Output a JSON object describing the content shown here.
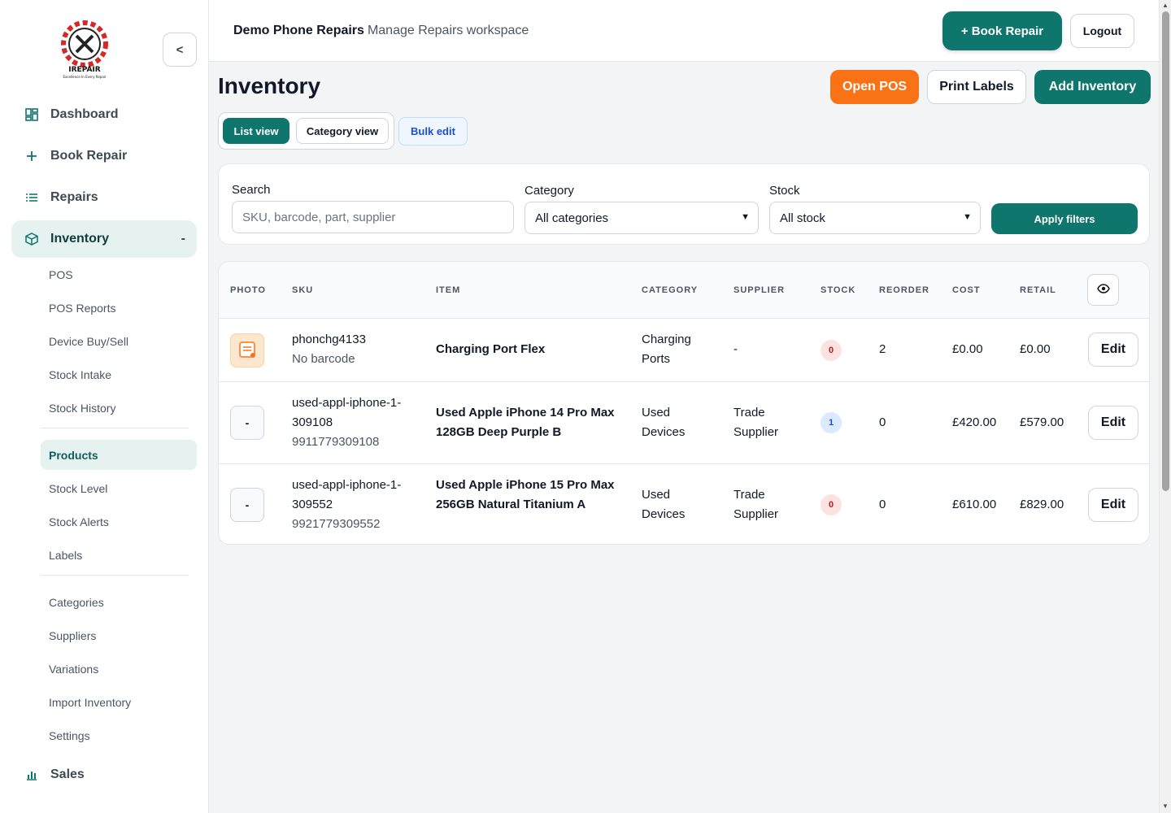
{
  "sidebar": {
    "logo_text": "IREPAIR",
    "logo_tagline": "Excellence In Every Repair",
    "collapse_label": "<",
    "top_items": [
      {
        "label": "Dashboard",
        "icon": "dashboard-icon"
      },
      {
        "label": "Book Repair",
        "icon": "plus-icon"
      },
      {
        "label": "Repairs",
        "icon": "list-icon"
      },
      {
        "label": "Inventory",
        "icon": "box-icon",
        "active": true,
        "toggle": "-"
      }
    ],
    "inventory_sub_group1": [
      "POS",
      "POS Reports",
      "Device Buy/Sell",
      "Stock Intake",
      "Stock History"
    ],
    "inventory_sub_group2": [
      "Products",
      "Stock Level",
      "Stock Alerts",
      "Labels"
    ],
    "inventory_sub_group3": [
      "Categories",
      "Suppliers",
      "Variations",
      "Import Inventory",
      "Settings"
    ],
    "bottom_item": {
      "label": "Sales",
      "icon": "bar-chart-icon"
    }
  },
  "header": {
    "business_name": "Demo Phone Repairs",
    "workspace": "Manage Repairs workspace",
    "book_repair_label": "+ Book Repair",
    "logout_label": "Logout"
  },
  "page": {
    "title": "Inventory",
    "open_pos_label": "Open POS",
    "print_labels_label": "Print Labels",
    "add_inventory_label": "Add Inventory",
    "list_view_label": "List view",
    "category_view_label": "Category view",
    "bulk_edit_label": "Bulk edit"
  },
  "filters": {
    "search_label": "Search",
    "search_placeholder": "SKU, barcode, part, supplier",
    "category_label": "Category",
    "category_value": "All categories",
    "stock_label": "Stock",
    "stock_value": "All stock",
    "apply_label": "Apply filters"
  },
  "table": {
    "columns": [
      "PHOTO",
      "SKU",
      "ITEM",
      "CATEGORY",
      "SUPPLIER",
      "STOCK",
      "REORDER",
      "COST",
      "RETAIL"
    ],
    "edit_label": "Edit",
    "rows": [
      {
        "photo": "",
        "sku": "phonchg4133",
        "barcode": "No barcode",
        "item": "Charging Port Flex",
        "category": "Charging Ports",
        "supplier": "-",
        "stock": "0",
        "reorder": "2",
        "cost": "£0.00",
        "retail": "£0.00"
      },
      {
        "photo": "-",
        "sku": "used-appl-iphone-1-309108",
        "barcode": "9911779309108",
        "item": "Used Apple iPhone 14 Pro Max 128GB Deep Purple B",
        "category": "Used Devices",
        "supplier": "Trade Supplier",
        "stock": "1",
        "reorder": "0",
        "cost": "£420.00",
        "retail": "£579.00"
      },
      {
        "photo": "-",
        "sku": "used-appl-iphone-1-309552",
        "barcode": "9921779309552",
        "item": "Used Apple iPhone 15 Pro Max 256GB Natural Titanium A",
        "category": "Used Devices",
        "supplier": "Trade Supplier",
        "stock": "0",
        "reorder": "0",
        "cost": "£610.00",
        "retail": "£829.00"
      }
    ]
  },
  "colors": {
    "primary": "#0f766e",
    "accent": "#f97316",
    "badge_zero_bg": "#fde2e2",
    "badge_zero_fg": "#b91c1c",
    "badge_pos_bg": "#dbeafe",
    "badge_pos_fg": "#1d4ed8"
  }
}
